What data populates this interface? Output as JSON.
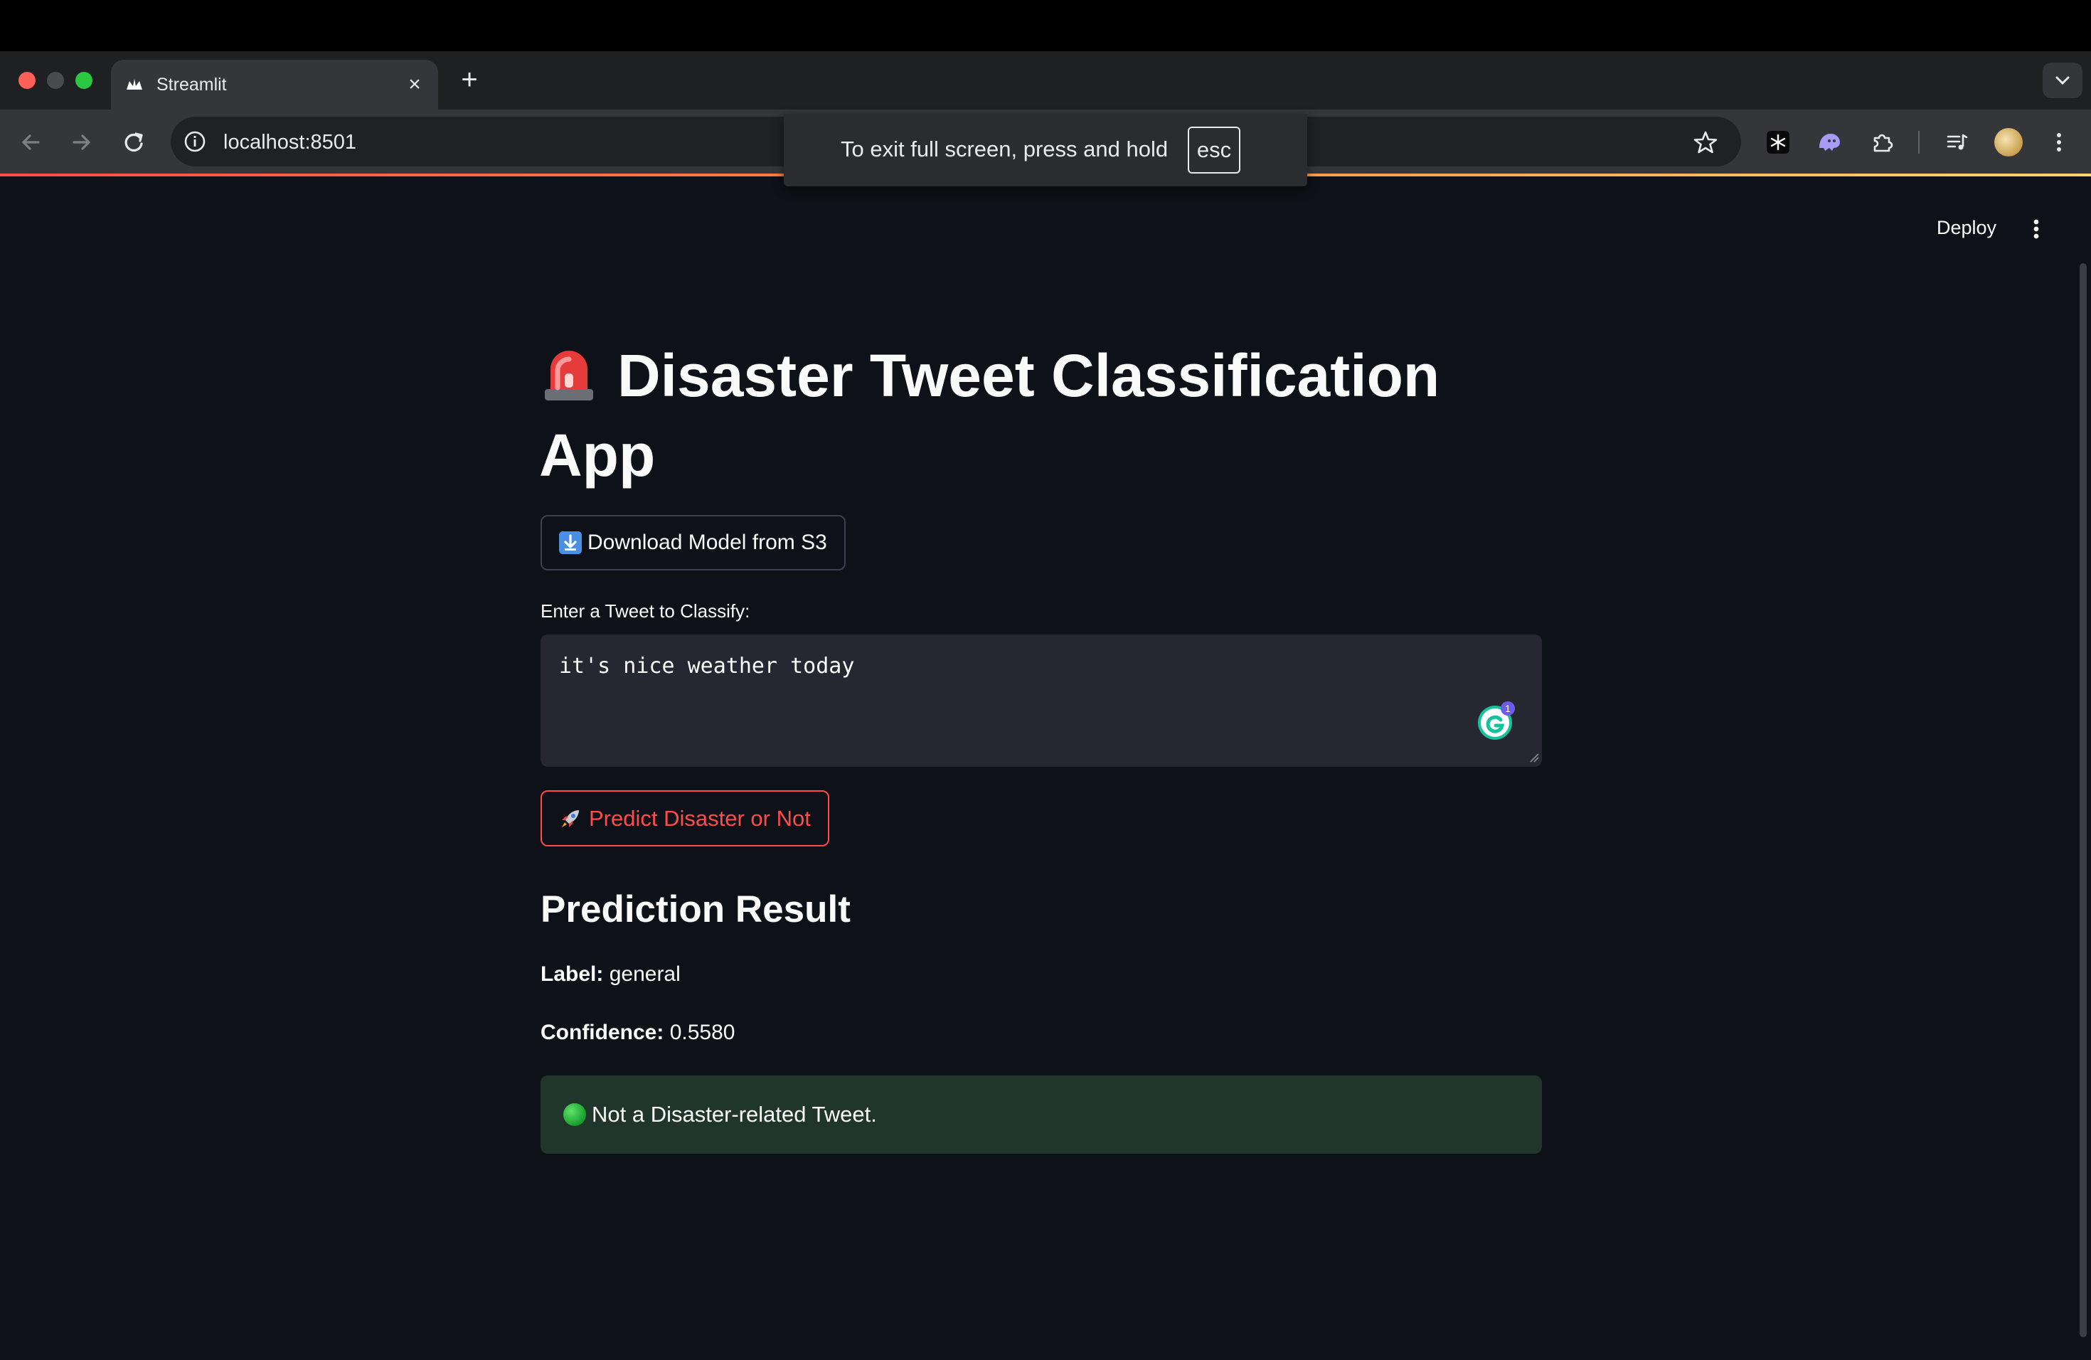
{
  "browser": {
    "tab_title": "Streamlit",
    "url": "localhost:8501",
    "fullscreen_notice": "To exit full screen, press and hold",
    "fullscreen_key": "esc"
  },
  "app": {
    "deploy_label": "Deploy",
    "title": "Disaster Tweet Classification App",
    "download_button": "Download Model from S3",
    "input_label": "Enter a Tweet to Classify:",
    "input_value": "it's nice weather today",
    "predict_button": "Predict Disaster or Not",
    "result_heading": "Prediction Result",
    "label_key": "Label:",
    "label_value": "general",
    "confidence_key": "Confidence:",
    "confidence_value": "0.5580",
    "result_message": "Not a Disaster-related Tweet."
  },
  "colors": {
    "app_background": "#0e1117",
    "primary": "#ff4b4b",
    "success_background": "#21362a",
    "input_background": "#262730"
  },
  "icons": [
    "back-icon",
    "forward-icon",
    "reload-icon",
    "site-info-icon",
    "bookmark-star-icon",
    "extension-icon",
    "media-control-icon",
    "siren-emoji-icon",
    "download-arrow-icon",
    "rocket-icon",
    "green-circle-icon",
    "grammarly-icon"
  ]
}
